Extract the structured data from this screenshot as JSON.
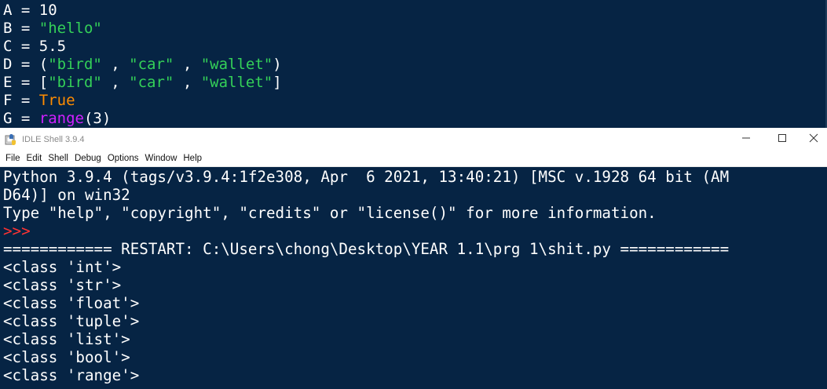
{
  "editor": {
    "lines": [
      [
        {
          "t": "A = 10",
          "c": "plain"
        }
      ],
      [
        {
          "t": "B = ",
          "c": "plain"
        },
        {
          "t": "\"hello\"",
          "c": "string"
        }
      ],
      [
        {
          "t": "C = 5.5",
          "c": "plain"
        }
      ],
      [
        {
          "t": "D = (",
          "c": "plain"
        },
        {
          "t": "\"bird\"",
          "c": "string"
        },
        {
          "t": " , ",
          "c": "plain"
        },
        {
          "t": "\"car\"",
          "c": "string"
        },
        {
          "t": " , ",
          "c": "plain"
        },
        {
          "t": "\"wallet\"",
          "c": "string"
        },
        {
          "t": ")",
          "c": "plain"
        }
      ],
      [
        {
          "t": "E = [",
          "c": "plain"
        },
        {
          "t": "\"bird\"",
          "c": "string"
        },
        {
          "t": " , ",
          "c": "plain"
        },
        {
          "t": "\"car\"",
          "c": "string"
        },
        {
          "t": " , ",
          "c": "plain"
        },
        {
          "t": "\"wallet\"",
          "c": "string"
        },
        {
          "t": "]",
          "c": "plain"
        }
      ],
      [
        {
          "t": "F = ",
          "c": "plain"
        },
        {
          "t": "True",
          "c": "kw"
        }
      ],
      [
        {
          "t": "G = ",
          "c": "plain"
        },
        {
          "t": "range",
          "c": "builtin"
        },
        {
          "t": "(3)",
          "c": "plain"
        }
      ]
    ]
  },
  "window": {
    "title": "IDLE Shell 3.9.4",
    "minimize_icon": "minimize-icon",
    "maximize_icon": "maximize-icon",
    "close_icon": "close-icon"
  },
  "menu": {
    "items": [
      "File",
      "Edit",
      "Shell",
      "Debug",
      "Options",
      "Window",
      "Help"
    ]
  },
  "shell": {
    "banner_1": "Python 3.9.4 (tags/v3.9.4:1f2e308, Apr  6 2021, 13:40:21) [MSC v.1928 64 bit (AM",
    "banner_2": "D64)] on win32",
    "banner_3": "Type \"help\", \"copyright\", \"credits\" or \"license()\" for more information.",
    "prompt": ">>>",
    "restart": "============ RESTART: C:\\Users\\chong\\Desktop\\YEAR 1.1\\prg 1\\shit.py ============",
    "outputs": [
      "<class 'int'>",
      "<class 'str'>",
      "<class 'float'>",
      "<class 'tuple'>",
      "<class 'list'>",
      "<class 'bool'>",
      "<class 'range'>"
    ]
  },
  "colors": {
    "background": "#062444",
    "string": "#34d058",
    "keyword": "#ff8c00",
    "builtin": "#d020ff",
    "prompt": "#ff3333"
  }
}
